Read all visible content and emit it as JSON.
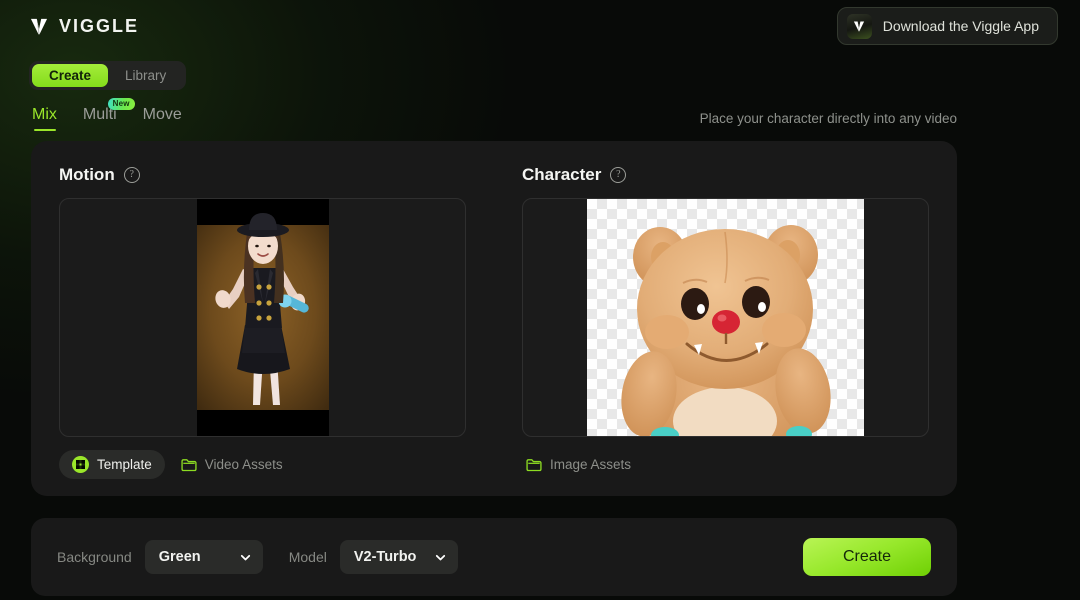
{
  "header": {
    "brand": "VIGGLE",
    "brand_logo_icon": "viggle-v-logo-icon",
    "download_label": "Download the Viggle App",
    "download_logo_icon": "viggle-v-app-icon"
  },
  "segmented": {
    "items": [
      {
        "label": "Create",
        "active": true
      },
      {
        "label": "Library",
        "active": false
      }
    ]
  },
  "subtabs": {
    "items": [
      {
        "label": "Mix",
        "active": true,
        "badge": ""
      },
      {
        "label": "Multi",
        "active": false,
        "badge": "New"
      },
      {
        "label": "Move",
        "active": false,
        "badge": ""
      }
    ]
  },
  "tagline": "Place your character directly into any video",
  "panel": {
    "motion": {
      "title": "Motion",
      "help_icon": "question-circle-icon",
      "thumbnail_alt": "woman in dark dress and hat holding a microphone on amber background",
      "buttons": [
        {
          "label": "Template",
          "icon": "template-grid-icon",
          "style": "filled"
        },
        {
          "label": "Video Assets",
          "icon": "folder-icon",
          "style": "plain"
        }
      ]
    },
    "character": {
      "title": "Character",
      "help_icon": "question-circle-icon",
      "thumbnail_alt": "brown plush teddy bear on transparent checkerboard background",
      "buttons": [
        {
          "label": "Image Assets",
          "icon": "folder-icon",
          "style": "plain"
        }
      ]
    }
  },
  "bottombar": {
    "background_label": "Background",
    "background_value": "Green",
    "model_label": "Model",
    "model_value": "V2-Turbo",
    "chevron_icon": "chevron-down-icon",
    "create_label": "Create"
  },
  "colors": {
    "accent_green": "#9ae62a",
    "page_bg": "#080a08",
    "panel_bg": "#191919",
    "badge_gradient_start": "#3ee0c8",
    "badge_gradient_end": "#8cf03d"
  }
}
